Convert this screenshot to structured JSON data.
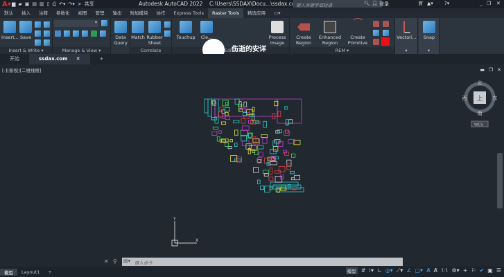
{
  "titlebar": {
    "app_title": "Autodesk AutoCAD 2022",
    "file_path": "C:\\Users\\SSDAX\\Docu...\\ssdax.com.dwg",
    "share_label": "共享",
    "search_placeholder": "键入关键字或短语",
    "login_label": "登录"
  },
  "ribbon_tabs": [
    "默认",
    "插入",
    "注释",
    "参数化",
    "视图",
    "管理",
    "输出",
    "附加模块",
    "协作",
    "Express Tools",
    "Raster Tools",
    "精选应用"
  ],
  "active_tab": "Raster Tools",
  "panels": {
    "insert_write": {
      "label": "Insert & Write",
      "buttons": [
        "Insert...",
        "Save"
      ]
    },
    "manage_view": {
      "label": "Manage & View"
    },
    "correlate": {
      "label": "Correlate",
      "buttons": [
        "Data Query",
        "Match",
        "Rubber Sheet"
      ]
    },
    "edit": {
      "label": "Edit",
      "buttons": [
        "Touchup",
        "Cle...",
        "Process Image"
      ]
    },
    "rem": {
      "label": "REM",
      "buttons": [
        "Create Region",
        "Enhanced Region",
        "Create Primitive"
      ],
      "color_swatch": "#e8111a"
    },
    "vectorize": {
      "buttons": [
        "Vectori..."
      ]
    },
    "snap": {
      "buttons": [
        "Snap"
      ]
    }
  },
  "watermark": "伤逝的安详",
  "doc_tabs": [
    "开始",
    "ssdax.com"
  ],
  "viewport": {
    "view_label": "[-][俯视][二维线框]",
    "viewcube": {
      "face": "上",
      "north": "北",
      "south": "南",
      "east": "东",
      "west": "西",
      "ucs": "WCS"
    }
  },
  "command": {
    "placeholder": "键入命令"
  },
  "layout_tabs": [
    "模型",
    "Layout1"
  ],
  "status": {
    "model_label": "模型",
    "scale": "1:1"
  }
}
